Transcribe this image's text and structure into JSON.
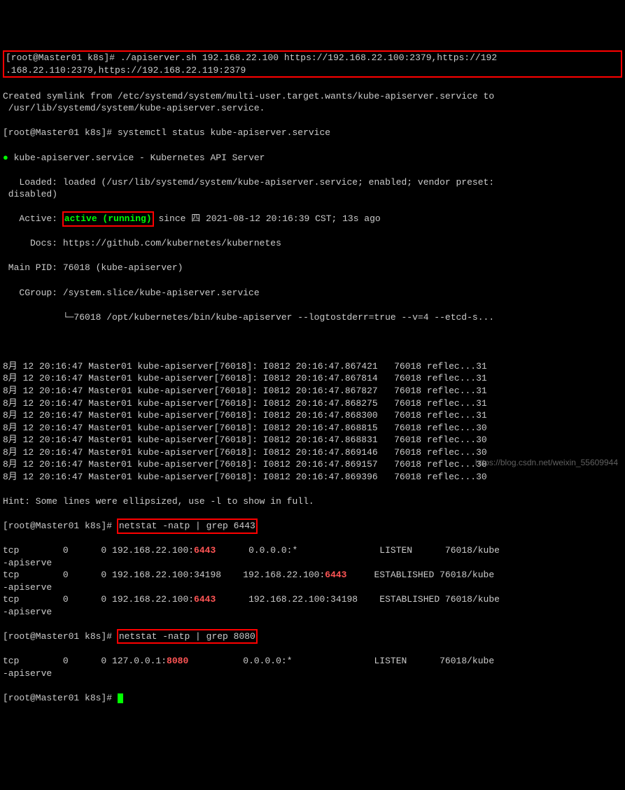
{
  "cmd1": {
    "prompt": "[root@Master01 k8s]# ",
    "command": "./apiserver.sh 192.168.22.100 https://192.168.22.100:2379,https://192.168.22.110:2379,https://192.168.22.119:2379"
  },
  "symlink_line": "Created symlink from /etc/systemd/system/multi-user.target.wants/kube-apiserver.service to /usr/lib/systemd/system/kube-apiserver.service.",
  "cmd2": {
    "prompt": "[root@Master01 k8s]# ",
    "command": "systemctl status kube-apiserver.service"
  },
  "status": {
    "dot": "●",
    "name": "kube-apiserver.service - Kubernetes API Server",
    "loaded": "   Loaded: loaded (/usr/lib/systemd/system/kube-apiserver.service; enabled; vendor preset: disabled)",
    "active_label": "   Active: ",
    "active_value": "active (running)",
    "active_since": " since 四 2021-08-12 20:16:39 CST; 13s ago",
    "docs": "     Docs: https://github.com/kubernetes/kubernetes",
    "mainpid": " Main PID: 76018 (kube-apiserver)",
    "cgroup1": "   CGroup: /system.slice/kube-apiserver.service",
    "cgroup2": "           └─76018 /opt/kubernetes/bin/kube-apiserver --logtostderr=true --v=4 --etcd-s..."
  },
  "logs": [
    "8月 12 20:16:47 Master01 kube-apiserver[76018]: I0812 20:16:47.867421   76018 reflec...31",
    "8月 12 20:16:47 Master01 kube-apiserver[76018]: I0812 20:16:47.867814   76018 reflec...31",
    "8月 12 20:16:47 Master01 kube-apiserver[76018]: I0812 20:16:47.867827   76018 reflec...31",
    "8月 12 20:16:47 Master01 kube-apiserver[76018]: I0812 20:16:47.868275   76018 reflec...31",
    "8月 12 20:16:47 Master01 kube-apiserver[76018]: I0812 20:16:47.868300   76018 reflec...31",
    "8月 12 20:16:47 Master01 kube-apiserver[76018]: I0812 20:16:47.868815   76018 reflec...30",
    "8月 12 20:16:47 Master01 kube-apiserver[76018]: I0812 20:16:47.868831   76018 reflec...30",
    "8月 12 20:16:47 Master01 kube-apiserver[76018]: I0812 20:16:47.869146   76018 reflec...30",
    "8月 12 20:16:47 Master01 kube-apiserver[76018]: I0812 20:16:47.869157   76018 reflec...30",
    "8月 12 20:16:47 Master01 kube-apiserver[76018]: I0812 20:16:47.869396   76018 reflec...30"
  ],
  "hint": "Hint: Some lines were ellipsized, use -l to show in full.",
  "cmd3": {
    "prompt": "[root@Master01 k8s]# ",
    "command": "netstat -natp | grep 6443"
  },
  "netstat1": [
    {
      "pre": "tcp        0      0 192.168.22.100:",
      "port": "6443",
      "mid": "      0.0.0.0:*               LISTEN      76018/kube-apiserve"
    },
    {
      "pre": "tcp        0      0 192.168.22.100:34198    192.168.22.100:",
      "port": "6443",
      "mid": "     ESTABLISHED 76018/kube-apiserve"
    },
    {
      "pre": "tcp        0      0 192.168.22.100:",
      "port": "6443",
      "mid": "      192.168.22.100:34198    ESTABLISHED 76018/kube-apiserve"
    }
  ],
  "cmd4": {
    "prompt": "[root@Master01 k8s]# ",
    "command": "netstat -natp | grep 8080"
  },
  "netstat2": [
    {
      "pre": "tcp        0      0 127.0.0.1:",
      "port": "8080",
      "mid": "          0.0.0.0:*               LISTEN      76018/kube-apiserve"
    }
  ],
  "cmd5": {
    "prompt": "[root@Master01 k8s]# "
  },
  "watermark": "https://blog.csdn.net/weixin_55609944"
}
